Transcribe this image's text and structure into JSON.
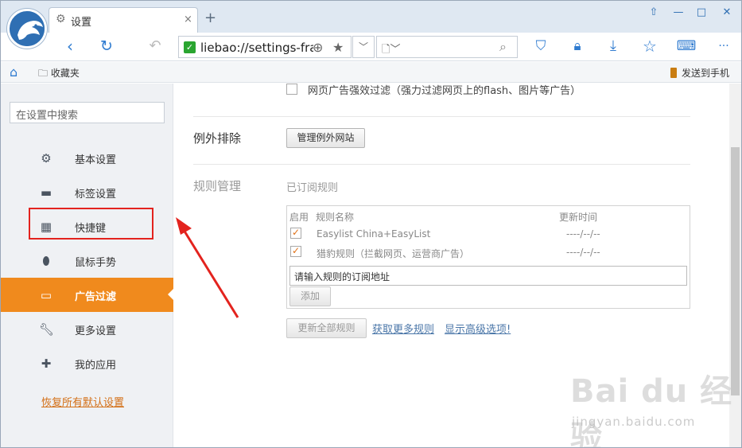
{
  "tab": {
    "title": "设置",
    "close": "×",
    "new": "+"
  },
  "window_controls": [
    "⇧",
    "—",
    "□",
    "✕"
  ],
  "toolbar": {
    "url": "liebao://settings-fra",
    "more": "···"
  },
  "bookmarks": {
    "favorites": "收藏夹",
    "send_to_phone": "发送到手机"
  },
  "sidebar": {
    "search_placeholder": "在设置中搜索",
    "items": [
      {
        "label": "基本设置",
        "icon": "gear-icon"
      },
      {
        "label": "标签设置",
        "icon": "laptop-icon"
      },
      {
        "label": "快捷键",
        "icon": "keyboard-icon"
      },
      {
        "label": "鼠标手势",
        "icon": "mouse-icon"
      },
      {
        "label": "广告过滤",
        "icon": "window-icon",
        "active": true
      },
      {
        "label": "更多设置",
        "icon": "wrench-icon"
      },
      {
        "label": "我的应用",
        "icon": "puzzle-icon"
      }
    ],
    "restore": "恢复所有默认设置"
  },
  "main": {
    "force_filter_label": "网页广告强效过滤（强力过滤网页上的flash、图片等广告）",
    "exceptions": {
      "title": "例外排除",
      "button": "管理例外网站"
    },
    "rules": {
      "title": "规则管理",
      "subscribed": "已订阅规则",
      "columns": {
        "enabled": "启用",
        "name": "规则名称",
        "updated": "更新时间"
      },
      "rows": [
        {
          "name": "Easylist China+EasyList",
          "updated": "----/--/--",
          "checked": true
        },
        {
          "name": "猎豹规则（拦截网页、运营商广告）",
          "updated": "----/--/--",
          "checked": true
        }
      ],
      "input_placeholder": "请输入规则的订阅地址",
      "add": "添加",
      "update_all": "更新全部规则",
      "get_more": "获取更多规则",
      "show_advanced": "显示高级选项!"
    }
  },
  "watermark": {
    "brand": "Bai du 经验",
    "url": "jingyan.baidu.com"
  },
  "colors": {
    "accent": "#f08a1d",
    "highlight": "#e3231e",
    "brand_blue": "#2f6fb3"
  }
}
